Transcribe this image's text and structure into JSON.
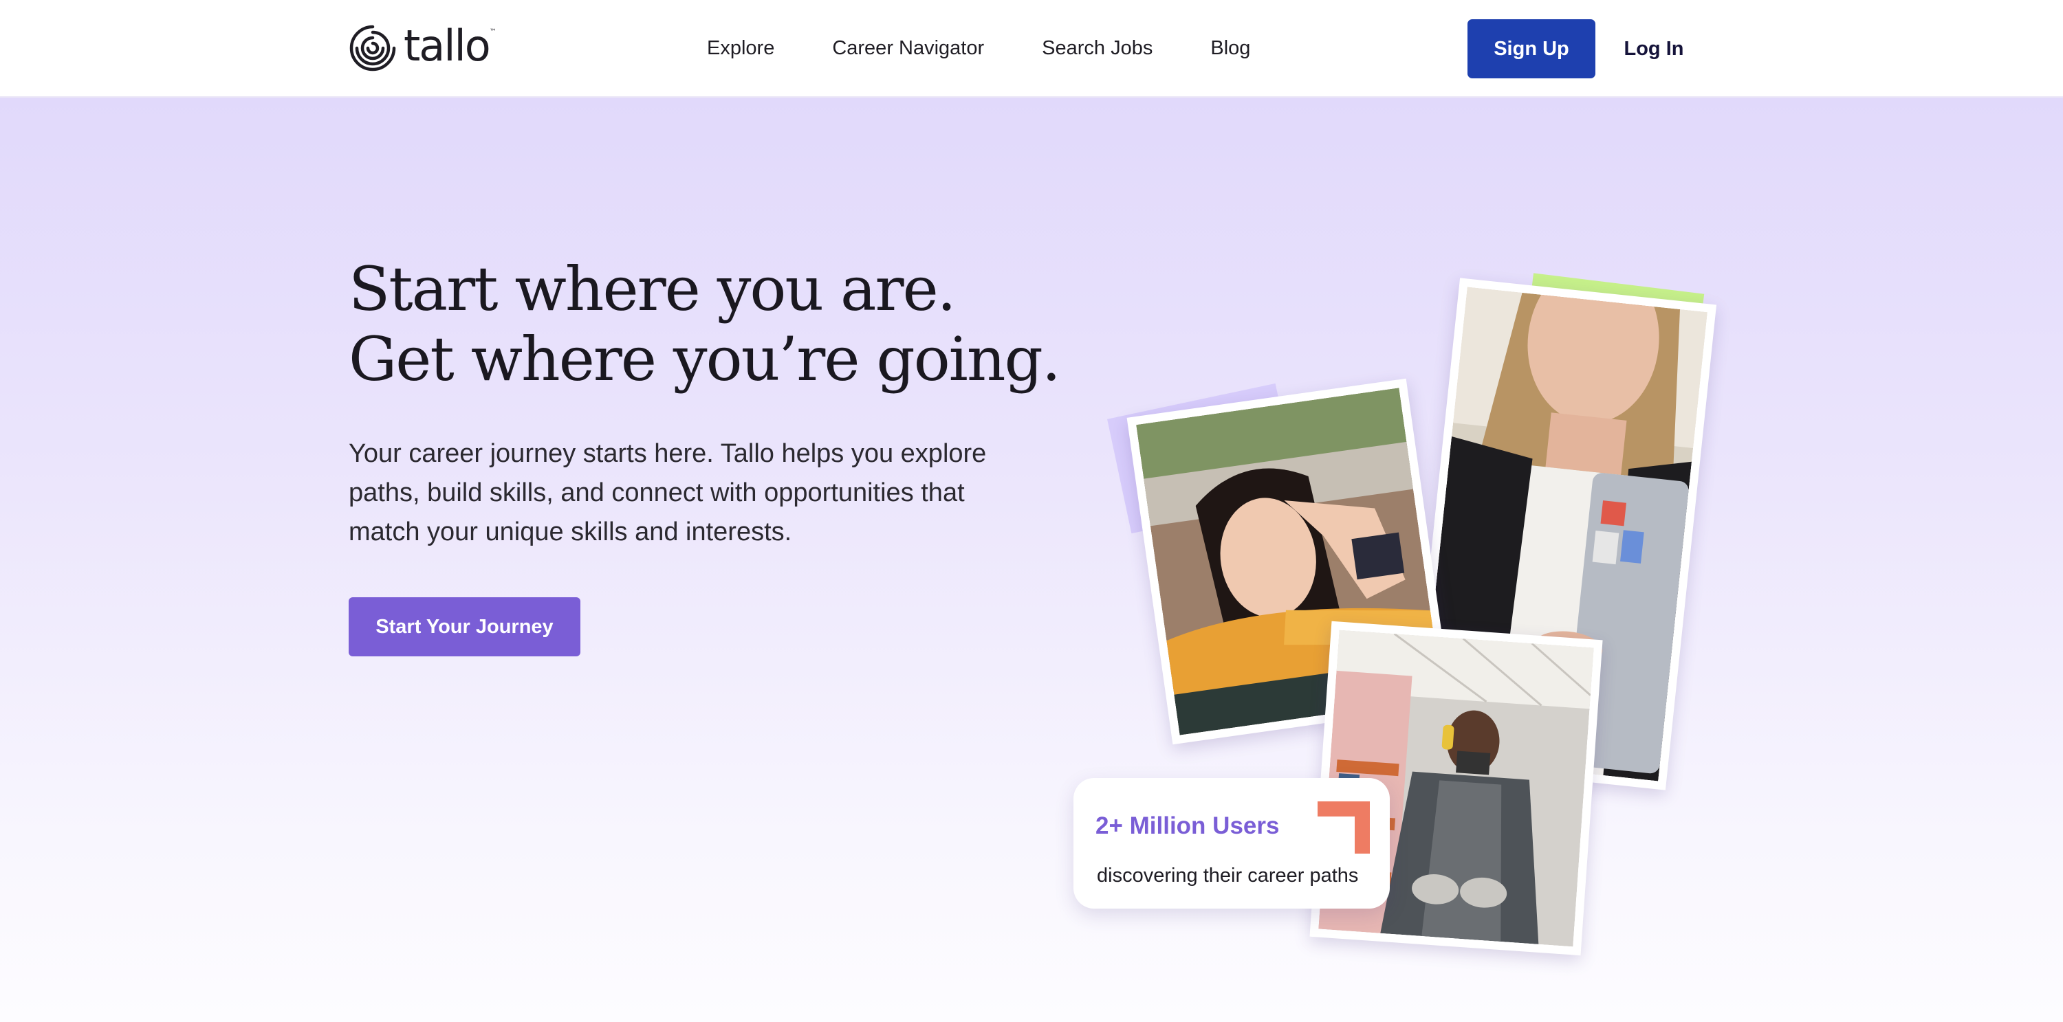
{
  "brand": {
    "name": "tallo",
    "trademark": "™"
  },
  "nav": {
    "items": [
      {
        "label": "Explore"
      },
      {
        "label": "Career Navigator"
      },
      {
        "label": "Search Jobs"
      },
      {
        "label": "Blog"
      }
    ]
  },
  "auth": {
    "signup_label": "Sign Up",
    "login_label": "Log In"
  },
  "hero": {
    "title_line1": "Start where you are.",
    "title_line2": "Get where you’re going.",
    "description": "Your career journey starts here. Tallo helps you explore paths, build skills, and connect with opportunities that match your unique skills and interests.",
    "cta_label": "Start Your Journey"
  },
  "stats": {
    "title": "2+ Million Users",
    "subtitle": "discovering their career paths"
  },
  "colors": {
    "primary_blue": "#1e40af",
    "accent_purple": "#7a5ed6",
    "lime_accent": "#c6f08a",
    "lilac_accent": "#d7ccfb",
    "coral_accent": "#ee7c63"
  },
  "icons": {
    "logo": "tallo-spiral-logo-icon",
    "stats_corner": "corner-bracket-icon"
  }
}
